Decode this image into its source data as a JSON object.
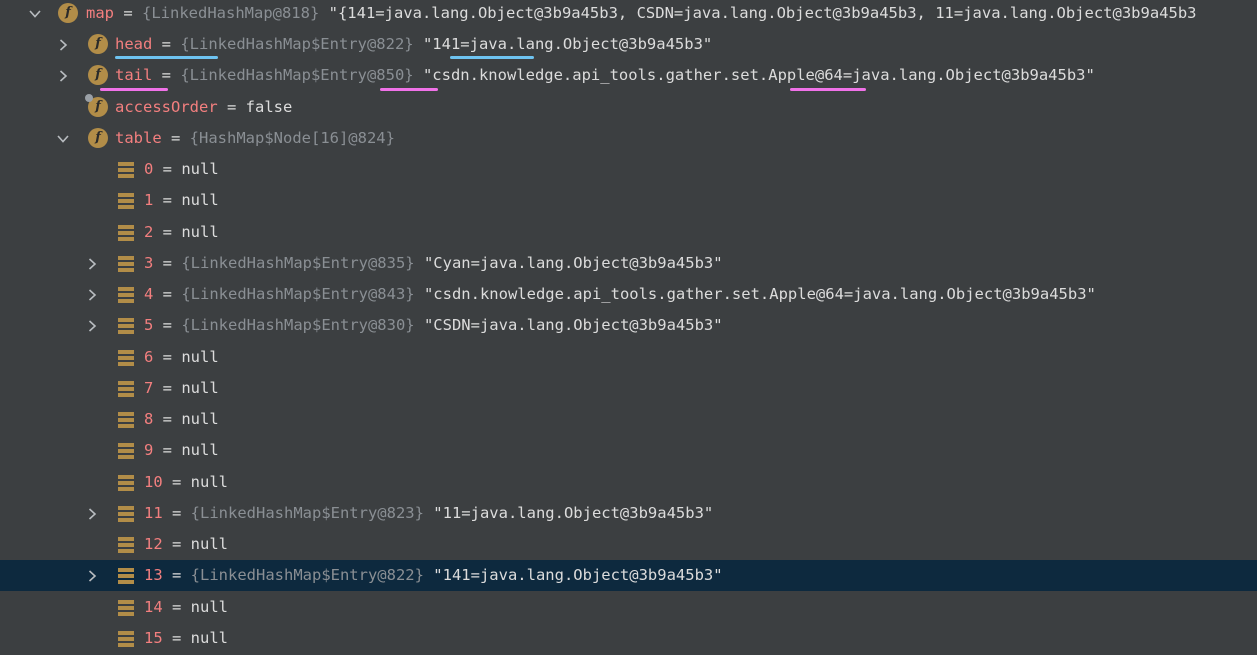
{
  "colors": {
    "background": "#3c3f41",
    "selected_row": "#0d293e",
    "field_name": "#f37f7f",
    "type_hint": "#8a8f94",
    "value_text": "#dcdcdc",
    "field_icon": "#b28d48",
    "underline_blue": "#6ec3f0",
    "underline_pink": "#f072e8"
  },
  "icons": {
    "expand": "chevron-right-icon",
    "collapse": "chevron-down-icon",
    "field": "field-icon",
    "array_element": "array-element-icon"
  },
  "rows": {
    "map": {
      "name": "map",
      "eq": " = ",
      "type": "{LinkedHashMap@818}",
      "value": " \"{141=java.lang.Object@3b9a45b3, CSDN=java.lang.Object@3b9a45b3, 11=java.lang.Object@3b9a45b3"
    },
    "head": {
      "name": "head",
      "eq": " = ",
      "type": "{LinkedHashMap$Entry@822}",
      "value": " \"141=java.lang.Object@3b9a45b3\""
    },
    "tail": {
      "name": "tail",
      "eq": " = ",
      "type": "{LinkedHashMap$Entry@850}",
      "value": " \"csdn.knowledge.api_tools.gather.set.Apple@64=java.lang.Object@3b9a45b3\""
    },
    "accessOrder": {
      "name": "accessOrder",
      "eq": " = ",
      "value": "false"
    },
    "table": {
      "name": "table",
      "eq": " = ",
      "type": "{HashMap$Node[16]@824}"
    }
  },
  "table_entries": [
    {
      "index": "0",
      "eq": " = ",
      "type": "",
      "value": "null"
    },
    {
      "index": "1",
      "eq": " = ",
      "type": "",
      "value": "null"
    },
    {
      "index": "2",
      "eq": " = ",
      "type": "",
      "value": "null"
    },
    {
      "index": "3",
      "eq": " = ",
      "type": "{LinkedHashMap$Entry@835}",
      "value": " \"Cyan=java.lang.Object@3b9a45b3\""
    },
    {
      "index": "4",
      "eq": " = ",
      "type": "{LinkedHashMap$Entry@843}",
      "value": " \"csdn.knowledge.api_tools.gather.set.Apple@64=java.lang.Object@3b9a45b3\""
    },
    {
      "index": "5",
      "eq": " = ",
      "type": "{LinkedHashMap$Entry@830}",
      "value": " \"CSDN=java.lang.Object@3b9a45b3\""
    },
    {
      "index": "6",
      "eq": " = ",
      "type": "",
      "value": "null"
    },
    {
      "index": "7",
      "eq": " = ",
      "type": "",
      "value": "null"
    },
    {
      "index": "8",
      "eq": " = ",
      "type": "",
      "value": "null"
    },
    {
      "index": "9",
      "eq": " = ",
      "type": "",
      "value": "null"
    },
    {
      "index": "10",
      "eq": " = ",
      "type": "",
      "value": "null"
    },
    {
      "index": "11",
      "eq": " = ",
      "type": "{LinkedHashMap$Entry@823}",
      "value": " \"11=java.lang.Object@3b9a45b3\""
    },
    {
      "index": "12",
      "eq": " = ",
      "type": "",
      "value": "null"
    },
    {
      "index": "13",
      "eq": " = ",
      "type": "{LinkedHashMap$Entry@822}",
      "value": " \"141=java.lang.Object@3b9a45b3\""
    },
    {
      "index": "14",
      "eq": " = ",
      "type": "",
      "value": "null"
    },
    {
      "index": "15",
      "eq": " = ",
      "type": "",
      "value": "null"
    }
  ]
}
